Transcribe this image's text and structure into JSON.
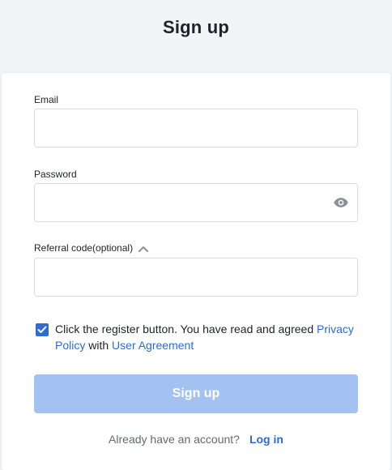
{
  "header": {
    "title": "Sign up"
  },
  "form": {
    "email": {
      "label": "Email",
      "value": "",
      "placeholder": ""
    },
    "password": {
      "label": "Password",
      "value": "",
      "placeholder": "",
      "toggle_icon": "eye-icon"
    },
    "referral": {
      "label": "Referral code(optional)",
      "value": "",
      "placeholder": "",
      "expanded": true,
      "toggle_icon": "chevron-up-icon"
    },
    "agreement": {
      "checked": true,
      "text": "Click the register button. You have read and agreed ",
      "privacy_link": "Privacy Policy",
      "middle": " with ",
      "user_agreement_link": "User Agreement"
    },
    "submit_label": "Sign up"
  },
  "footer": {
    "question": "Already have an account?",
    "login_link": "Log in"
  },
  "colors": {
    "accent": "#2f6bd8",
    "button_disabled": "#a3c2f2",
    "page_bg": "#f3f4f7"
  }
}
